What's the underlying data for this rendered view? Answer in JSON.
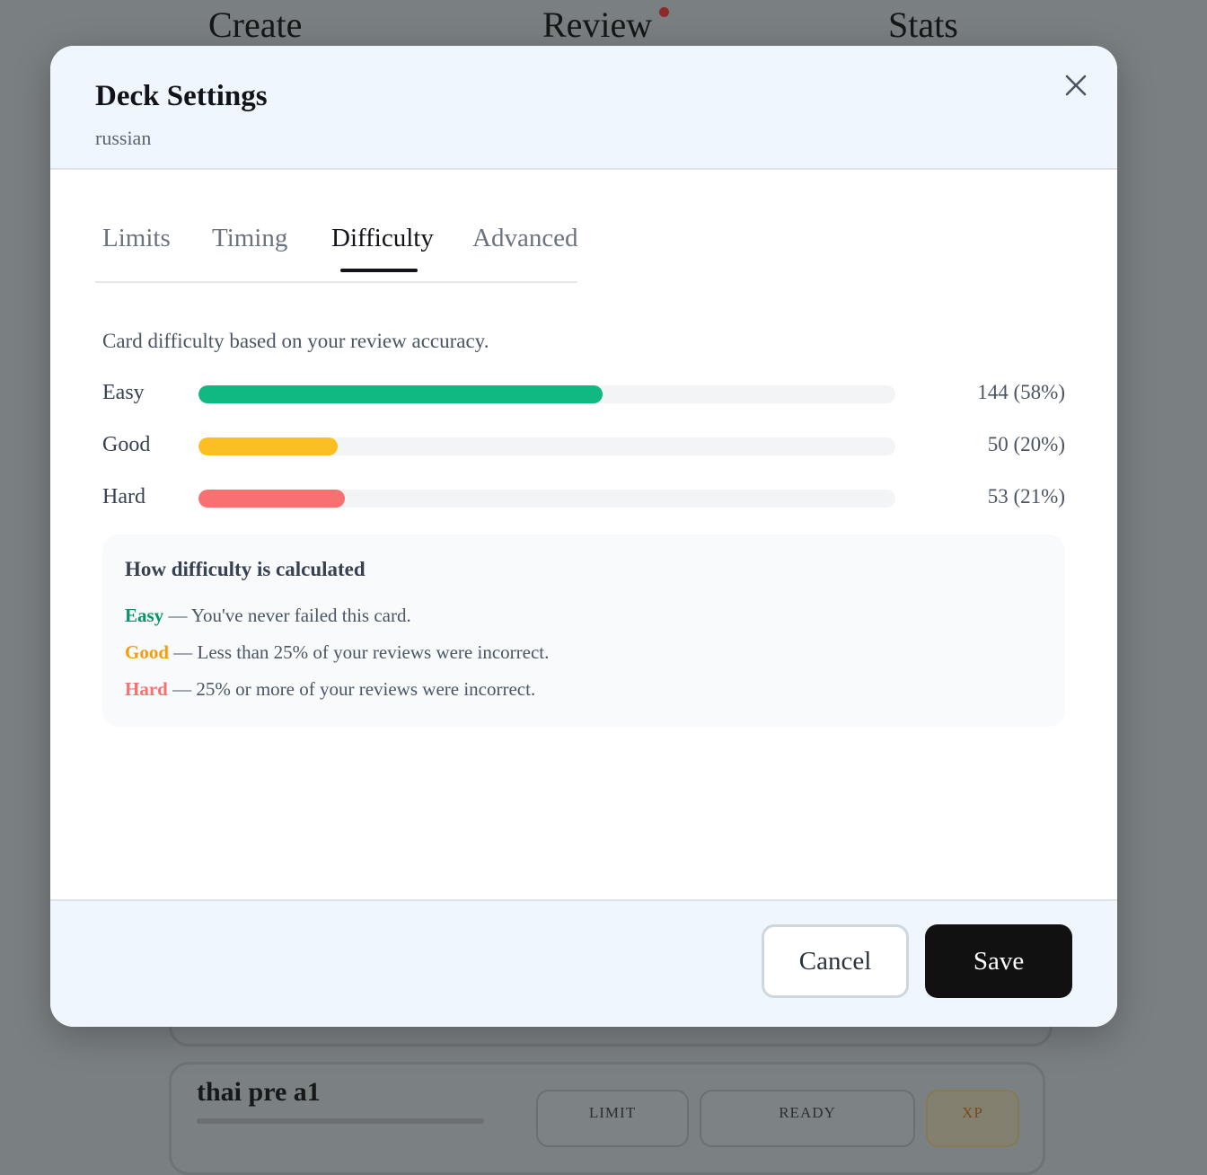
{
  "background": {
    "nav": {
      "create": "Create",
      "review": "Review",
      "stats": "Stats"
    },
    "deck_card": {
      "title": "thai pre a1",
      "limit": "LIMIT",
      "ready": "READY",
      "xp": "XP"
    }
  },
  "modal": {
    "title": "Deck Settings",
    "subtitle": "russian",
    "tabs": [
      {
        "label": "Limits",
        "active": false
      },
      {
        "label": "Timing",
        "active": false
      },
      {
        "label": "Difficulty",
        "active": true
      },
      {
        "label": "Advanced",
        "active": false
      }
    ],
    "description": "Card difficulty based on your review accuracy.",
    "difficulty": [
      {
        "label": "Easy",
        "count": "144 (58%)",
        "fraction": 0.58,
        "color": "#10b981"
      },
      {
        "label": "Good",
        "count": "50 (20%)",
        "fraction": 0.2,
        "color": "#fbbf24"
      },
      {
        "label": "Hard",
        "count": "53 (21%)",
        "fraction": 0.21,
        "color": "#f87171"
      }
    ],
    "info": {
      "title": "How difficulty is calculated",
      "lines": [
        {
          "term": "Easy",
          "text": " — You've never failed this card.",
          "color": "#059669"
        },
        {
          "term": "Good",
          "text": " — Less than 25% of your reviews were incorrect.",
          "color": "#f59e0b"
        },
        {
          "term": "Hard",
          "text": " — 25% or more of your reviews were incorrect.",
          "color": "#f87171"
        }
      ]
    },
    "footer": {
      "cancel": "Cancel",
      "save": "Save"
    },
    "close_icon": "close-icon"
  }
}
